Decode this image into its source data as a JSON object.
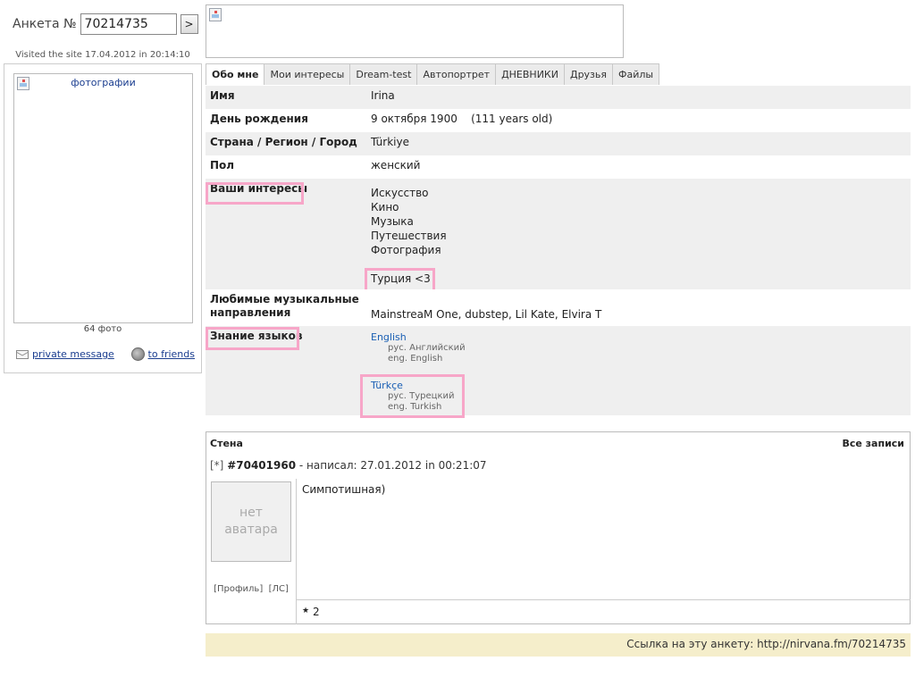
{
  "search": {
    "label": "Анкета №",
    "value": "70214735",
    "button_label": ">"
  },
  "visited": "Visited the site 17.04.2012 in 20:14:10",
  "photo": {
    "alt": "фотографии",
    "count": "64 фото"
  },
  "actions": {
    "message_label": "private message",
    "friends_label": "to friends"
  },
  "tabs": [
    {
      "label": "Обо мне"
    },
    {
      "label": "Мои интересы"
    },
    {
      "label": "Dream-test"
    },
    {
      "label": "Автопортрет"
    },
    {
      "label": "ДНЕВНИКИ"
    },
    {
      "label": "Друзья"
    },
    {
      "label": "Файлы"
    }
  ],
  "profile": {
    "name": {
      "key": "Имя",
      "value": "Irina"
    },
    "birthday": {
      "key": "День рождения",
      "value": "9 октября 1900    (111 years old)"
    },
    "location": {
      "key": "Страна / Регион / Город",
      "value": "Türkiye"
    },
    "gender": {
      "key": "Пол",
      "value": "женский"
    },
    "interests": {
      "key": "Ваши интересы",
      "items": [
        "Искусство",
        "Кино",
        "Музыка",
        "Путешествия",
        "Фотография"
      ],
      "extra": "Турция <3"
    },
    "music": {
      "key": "Любимые музыкальные направления",
      "value": "MainstreaM One, dubstep, Lil Kate, Elvira T"
    },
    "languages": {
      "key": "Знание языков",
      "items": [
        {
          "name": "English",
          "ru": "рус. Английский",
          "en": "eng. English"
        },
        {
          "name": "Türkçe",
          "ru": "рус. Турецкий",
          "en": "eng. Turkish"
        }
      ]
    }
  },
  "wall": {
    "title": "Стена",
    "all_label": "Все записи",
    "post": {
      "marker": "[*]",
      "id": "#70401960",
      "meta": " - написал: 27.01.2012 in 00:21:07",
      "avatar_text": "нет аватара",
      "profile_link": "[Профиль]",
      "pm_link": "[ЛС]",
      "text": "Симпотишная)",
      "stars": "2"
    }
  },
  "link_bar": {
    "text": "Ссылка на эту анкету: http://nirvana.fm/70214735"
  },
  "colors": {
    "highlight": "#f7a6c8",
    "link": "#1a3d8f",
    "link_bar_bg": "#f5eecb",
    "row_alt": "#efefef"
  }
}
